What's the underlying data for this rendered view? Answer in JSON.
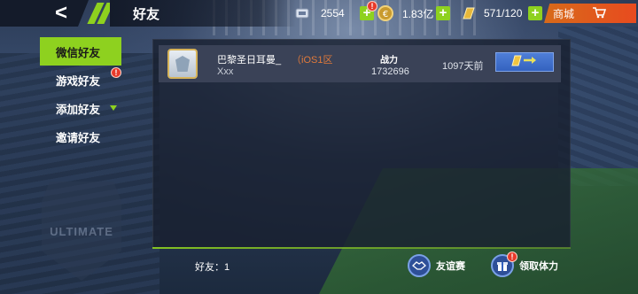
{
  "header": {
    "back_icon": "chevron-left-icon",
    "title": "好友"
  },
  "resources": {
    "tickets": {
      "icon": "ticket-icon",
      "value": "2554",
      "alert": "!"
    },
    "coins": {
      "icon": "coin-icon",
      "value": "1.83亿"
    },
    "energy": {
      "icon": "energy-icon",
      "value": "571/120"
    },
    "shop_label": "商城"
  },
  "sidebar": {
    "items": [
      {
        "label": "微信好友",
        "active": true
      },
      {
        "label": "游戏好友",
        "badge": "!"
      },
      {
        "label": "添加好友"
      },
      {
        "label": "邀请好友"
      }
    ],
    "logo_text": "ULTIMATE"
  },
  "friends": [
    {
      "name": "巴黎圣日耳曼_",
      "server": "（iOS1区",
      "sub": "Xxx",
      "power_label": "战力",
      "power": "1732696",
      "last_seen": "1097天前"
    }
  ],
  "footer": {
    "count_label": "好友：1",
    "friendly_match_label": "友谊赛",
    "claim_stamina_label": "领取体力",
    "claim_badge": "!"
  },
  "colors": {
    "accent": "#8ed11f",
    "shop": "#e84b1f",
    "server_text": "#e27a3a",
    "button_blue": "#3462bf"
  }
}
